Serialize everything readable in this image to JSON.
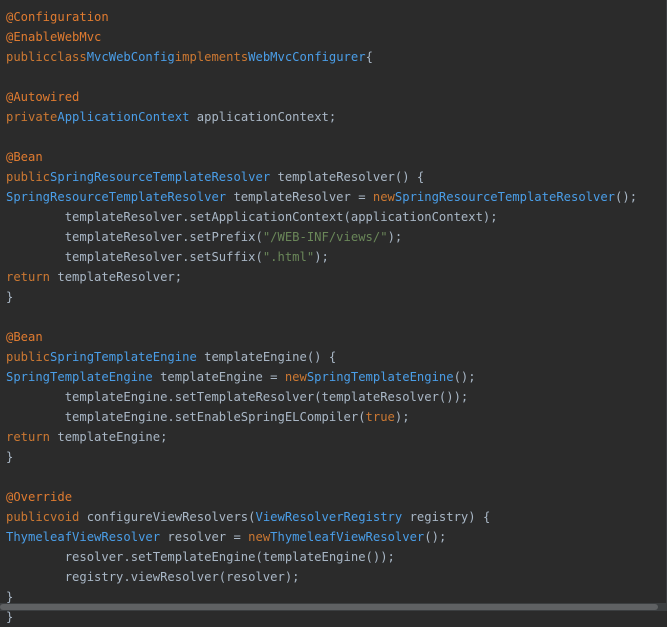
{
  "editor": {
    "colors": {
      "background": "#2b2b2b",
      "default_text": "#a9b7c6",
      "annotation": "#e07b30",
      "keyword": "#cc7832",
      "type": "#4a9ee8",
      "string": "#6a8759"
    },
    "lines": [
      [
        {
          "t": "annotation",
          "v": "@Configuration"
        }
      ],
      [
        {
          "t": "annotation",
          "v": "@EnableWebMvc"
        }
      ],
      [
        {
          "t": "keyword",
          "v": "publicclass"
        },
        {
          "t": "type",
          "v": "MvcWebConfig"
        },
        {
          "t": "keyword",
          "v": "implements"
        },
        {
          "t": "type",
          "v": "WebMvcConfigurer"
        },
        {
          "t": "plain",
          "v": "{"
        }
      ],
      [],
      [
        {
          "t": "annotation",
          "v": "@Autowired"
        }
      ],
      [
        {
          "t": "keyword",
          "v": "private"
        },
        {
          "t": "type",
          "v": "ApplicationContext"
        },
        {
          "t": "plain",
          "v": " applicationContext;"
        }
      ],
      [],
      [
        {
          "t": "annotation",
          "v": "@Bean"
        }
      ],
      [
        {
          "t": "keyword",
          "v": "public"
        },
        {
          "t": "type",
          "v": "SpringResourceTemplateResolver"
        },
        {
          "t": "plain",
          "v": " templateResolver() {"
        }
      ],
      [
        {
          "t": "type",
          "v": "SpringResourceTemplateResolver"
        },
        {
          "t": "plain",
          "v": " templateResolver = "
        },
        {
          "t": "keyword",
          "v": "new"
        },
        {
          "t": "type",
          "v": "SpringResourceTemplateResolver"
        },
        {
          "t": "plain",
          "v": "();"
        }
      ],
      [
        {
          "t": "plain",
          "v": "        templateResolver.setApplicationContext(applicationContext);"
        }
      ],
      [
        {
          "t": "plain",
          "v": "        templateResolver.setPrefix("
        },
        {
          "t": "string",
          "v": "\"/WEB-INF/views/\""
        },
        {
          "t": "plain",
          "v": ");"
        }
      ],
      [
        {
          "t": "plain",
          "v": "        templateResolver.setSuffix("
        },
        {
          "t": "string",
          "v": "\".html\""
        },
        {
          "t": "plain",
          "v": ");"
        }
      ],
      [
        {
          "t": "keyword",
          "v": "return"
        },
        {
          "t": "plain",
          "v": " templateResolver;"
        }
      ],
      [
        {
          "t": "plain",
          "v": "}"
        }
      ],
      [],
      [
        {
          "t": "annotation",
          "v": "@Bean"
        }
      ],
      [
        {
          "t": "keyword",
          "v": "public"
        },
        {
          "t": "type",
          "v": "SpringTemplateEngine"
        },
        {
          "t": "plain",
          "v": " templateEngine() {"
        }
      ],
      [
        {
          "t": "type",
          "v": "SpringTemplateEngine"
        },
        {
          "t": "plain",
          "v": " templateEngine = "
        },
        {
          "t": "keyword",
          "v": "new"
        },
        {
          "t": "type",
          "v": "SpringTemplateEngine"
        },
        {
          "t": "plain",
          "v": "();"
        }
      ],
      [
        {
          "t": "plain",
          "v": "        templateEngine.setTemplateResolver(templateResolver());"
        }
      ],
      [
        {
          "t": "plain",
          "v": "        templateEngine.setEnableSpringELCompiler("
        },
        {
          "t": "keyword",
          "v": "true"
        },
        {
          "t": "plain",
          "v": ");"
        }
      ],
      [
        {
          "t": "keyword",
          "v": "return"
        },
        {
          "t": "plain",
          "v": " templateEngine;"
        }
      ],
      [
        {
          "t": "plain",
          "v": "}"
        }
      ],
      [],
      [
        {
          "t": "annotation",
          "v": "@Override"
        }
      ],
      [
        {
          "t": "keyword",
          "v": "publicvoid"
        },
        {
          "t": "plain",
          "v": " configureViewResolvers("
        },
        {
          "t": "type",
          "v": "ViewResolverRegistry"
        },
        {
          "t": "plain",
          "v": " registry) {"
        }
      ],
      [
        {
          "t": "type",
          "v": "ThymeleafViewResolver"
        },
        {
          "t": "plain",
          "v": " resolver = "
        },
        {
          "t": "keyword",
          "v": "new"
        },
        {
          "t": "type",
          "v": "ThymeleafViewResolver"
        },
        {
          "t": "plain",
          "v": "();"
        }
      ],
      [
        {
          "t": "plain",
          "v": "        resolver.setTemplateEngine(templateEngine());"
        }
      ],
      [
        {
          "t": "plain",
          "v": "        registry.viewResolver(resolver);"
        }
      ],
      [
        {
          "t": "plain",
          "v": "}"
        }
      ],
      [
        {
          "t": "plain",
          "v": "}"
        }
      ]
    ]
  }
}
